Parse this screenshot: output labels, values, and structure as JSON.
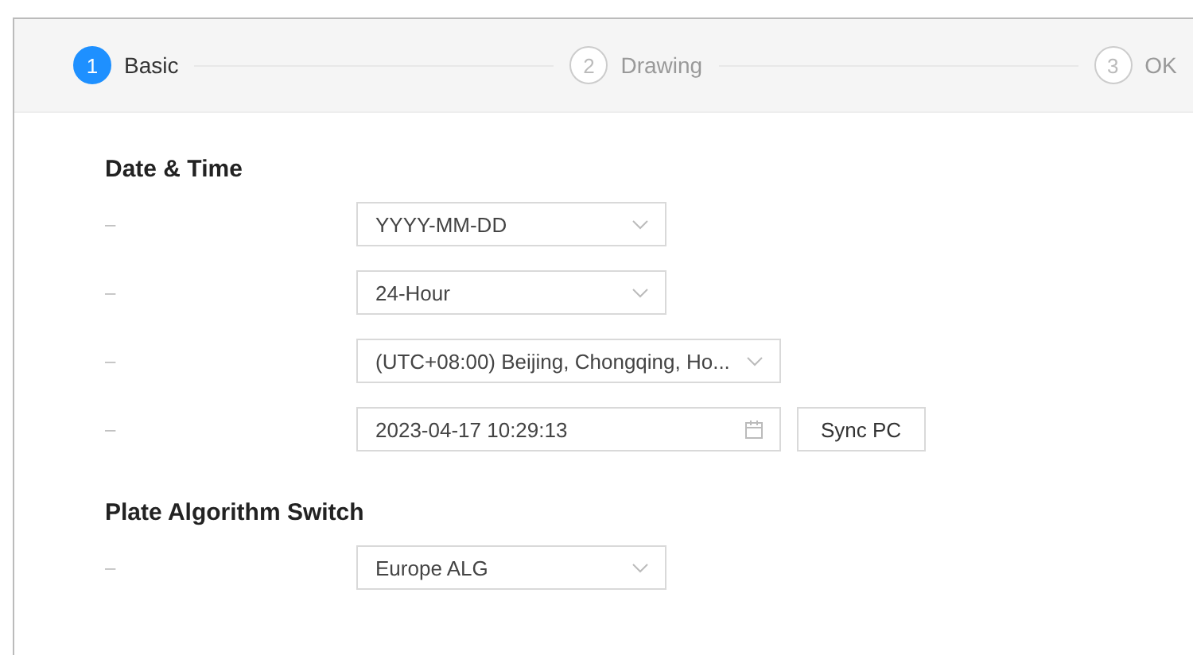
{
  "steps": [
    {
      "number": "1",
      "label": "Basic",
      "selected": true
    },
    {
      "number": "2",
      "label": "Drawing",
      "selected": false
    },
    {
      "number": "3",
      "label": "OK",
      "selected": false
    }
  ],
  "sections": [
    {
      "title": "Date & Time",
      "rows": [
        {
          "kind": "select",
          "label": "–",
          "value": "YYYY-MM-DD",
          "wide": false
        },
        {
          "kind": "select",
          "label": "–",
          "value": "24-Hour",
          "wide": false
        },
        {
          "kind": "select",
          "label": "–",
          "value": "(UTC+08:00) Beijing, Chongqing, Ho...",
          "wide": true
        },
        {
          "kind": "datetime",
          "label": "–",
          "value": "2023-04-17 10:29:13",
          "wide": true,
          "button": "Sync PC"
        }
      ]
    },
    {
      "title": "Plate Algorithm Switch",
      "rows": [
        {
          "kind": "select",
          "label": "–",
          "value": "Europe ALG",
          "wide": false
        }
      ]
    }
  ]
}
